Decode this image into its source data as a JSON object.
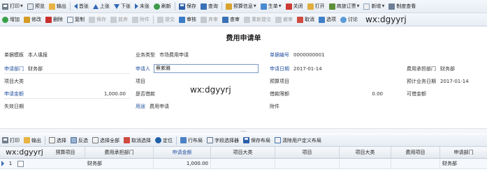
{
  "toolbar1": {
    "print": "打印",
    "preview": "预览",
    "export": "输出",
    "first": "首张",
    "prev": "上张",
    "next": "下张",
    "last": "末张",
    "refresh": "刷新",
    "save": "保存",
    "query": "查询",
    "budget_info": "预算信息",
    "generate": "生单",
    "close": "关闭",
    "open": "打开",
    "business": "商旅订票",
    "new": "新增",
    "view_settings": "制度查看"
  },
  "toolbar2": {
    "add": "增加",
    "edit": "修改",
    "delete": "删除",
    "copy": "复制",
    "save": "保存",
    "discard": "放弃",
    "attachment": "附件",
    "submit": "提交",
    "review": "审核",
    "abandon": "弃审",
    "query": "查审",
    "resubmit": "重新提交",
    "unaudit": "撤审",
    "cancel": "取消",
    "choose": "选项",
    "discuss": "讨论"
  },
  "form": {
    "title": "费用申请单",
    "watermark": "wx:dgyyrj",
    "fields": {
      "doc_type": {
        "label": "单据模板",
        "value": "本人填报"
      },
      "business_type": {
        "label": "业务类型",
        "value": "市场费用申请"
      },
      "doc_no": {
        "label": "单据编号",
        "value": "0000000001"
      },
      "apply_dept": {
        "label": "申请部门",
        "value": "财务部"
      },
      "applicant": {
        "label": "申请人",
        "value": "蔡紫雅"
      },
      "apply_date": {
        "label": "申请日期",
        "value": "2017-01-14"
      },
      "bear_dept": {
        "label": "费用承担部门",
        "value": "财务部"
      },
      "item_category": {
        "label": "项目大类",
        "value": ""
      },
      "item": {
        "label": "项目",
        "value": ""
      },
      "budget_item": {
        "label": "预算项目",
        "value": ""
      },
      "expected_date": {
        "label": "预计业务日期",
        "value": "2017-01-14"
      },
      "apply_amount": {
        "label": "申请金额",
        "value": "1,000.00"
      },
      "is_loan": {
        "label": "是否借款",
        "value": ""
      },
      "loan_limit": {
        "label": "借款限额",
        "value": "0.00"
      },
      "available_amount": {
        "label": "可借金额",
        "value": ""
      },
      "invalid_date": {
        "label": "失效日期",
        "value": ""
      },
      "purpose": {
        "label": "用途",
        "value": "费用申请"
      },
      "attachment": {
        "label": "附件",
        "value": ""
      }
    }
  },
  "splitter": "....",
  "grid_toolbar": {
    "print": "打印",
    "export": "输出",
    "choose": "选择",
    "invert": "反选",
    "select_all": "选择全部",
    "deselect": "取消选择",
    "locate": "定位",
    "row_layout": "行布局",
    "field_selector": "字段选择器",
    "save_layout": "保存布局",
    "clear_layout": "清除用户定义布局"
  },
  "grid": {
    "watermark": "wx:dgyyrj",
    "columns": [
      "预算项目",
      "费用承担部门",
      "申请金额",
      "项目大类",
      "项目",
      "项目大类",
      "费用项目",
      "申请部门"
    ],
    "rows": [
      {
        "index": "1",
        "bear_dept": "财务部",
        "amount": "1,000.00",
        "apply_dept": "财务部"
      }
    ]
  }
}
